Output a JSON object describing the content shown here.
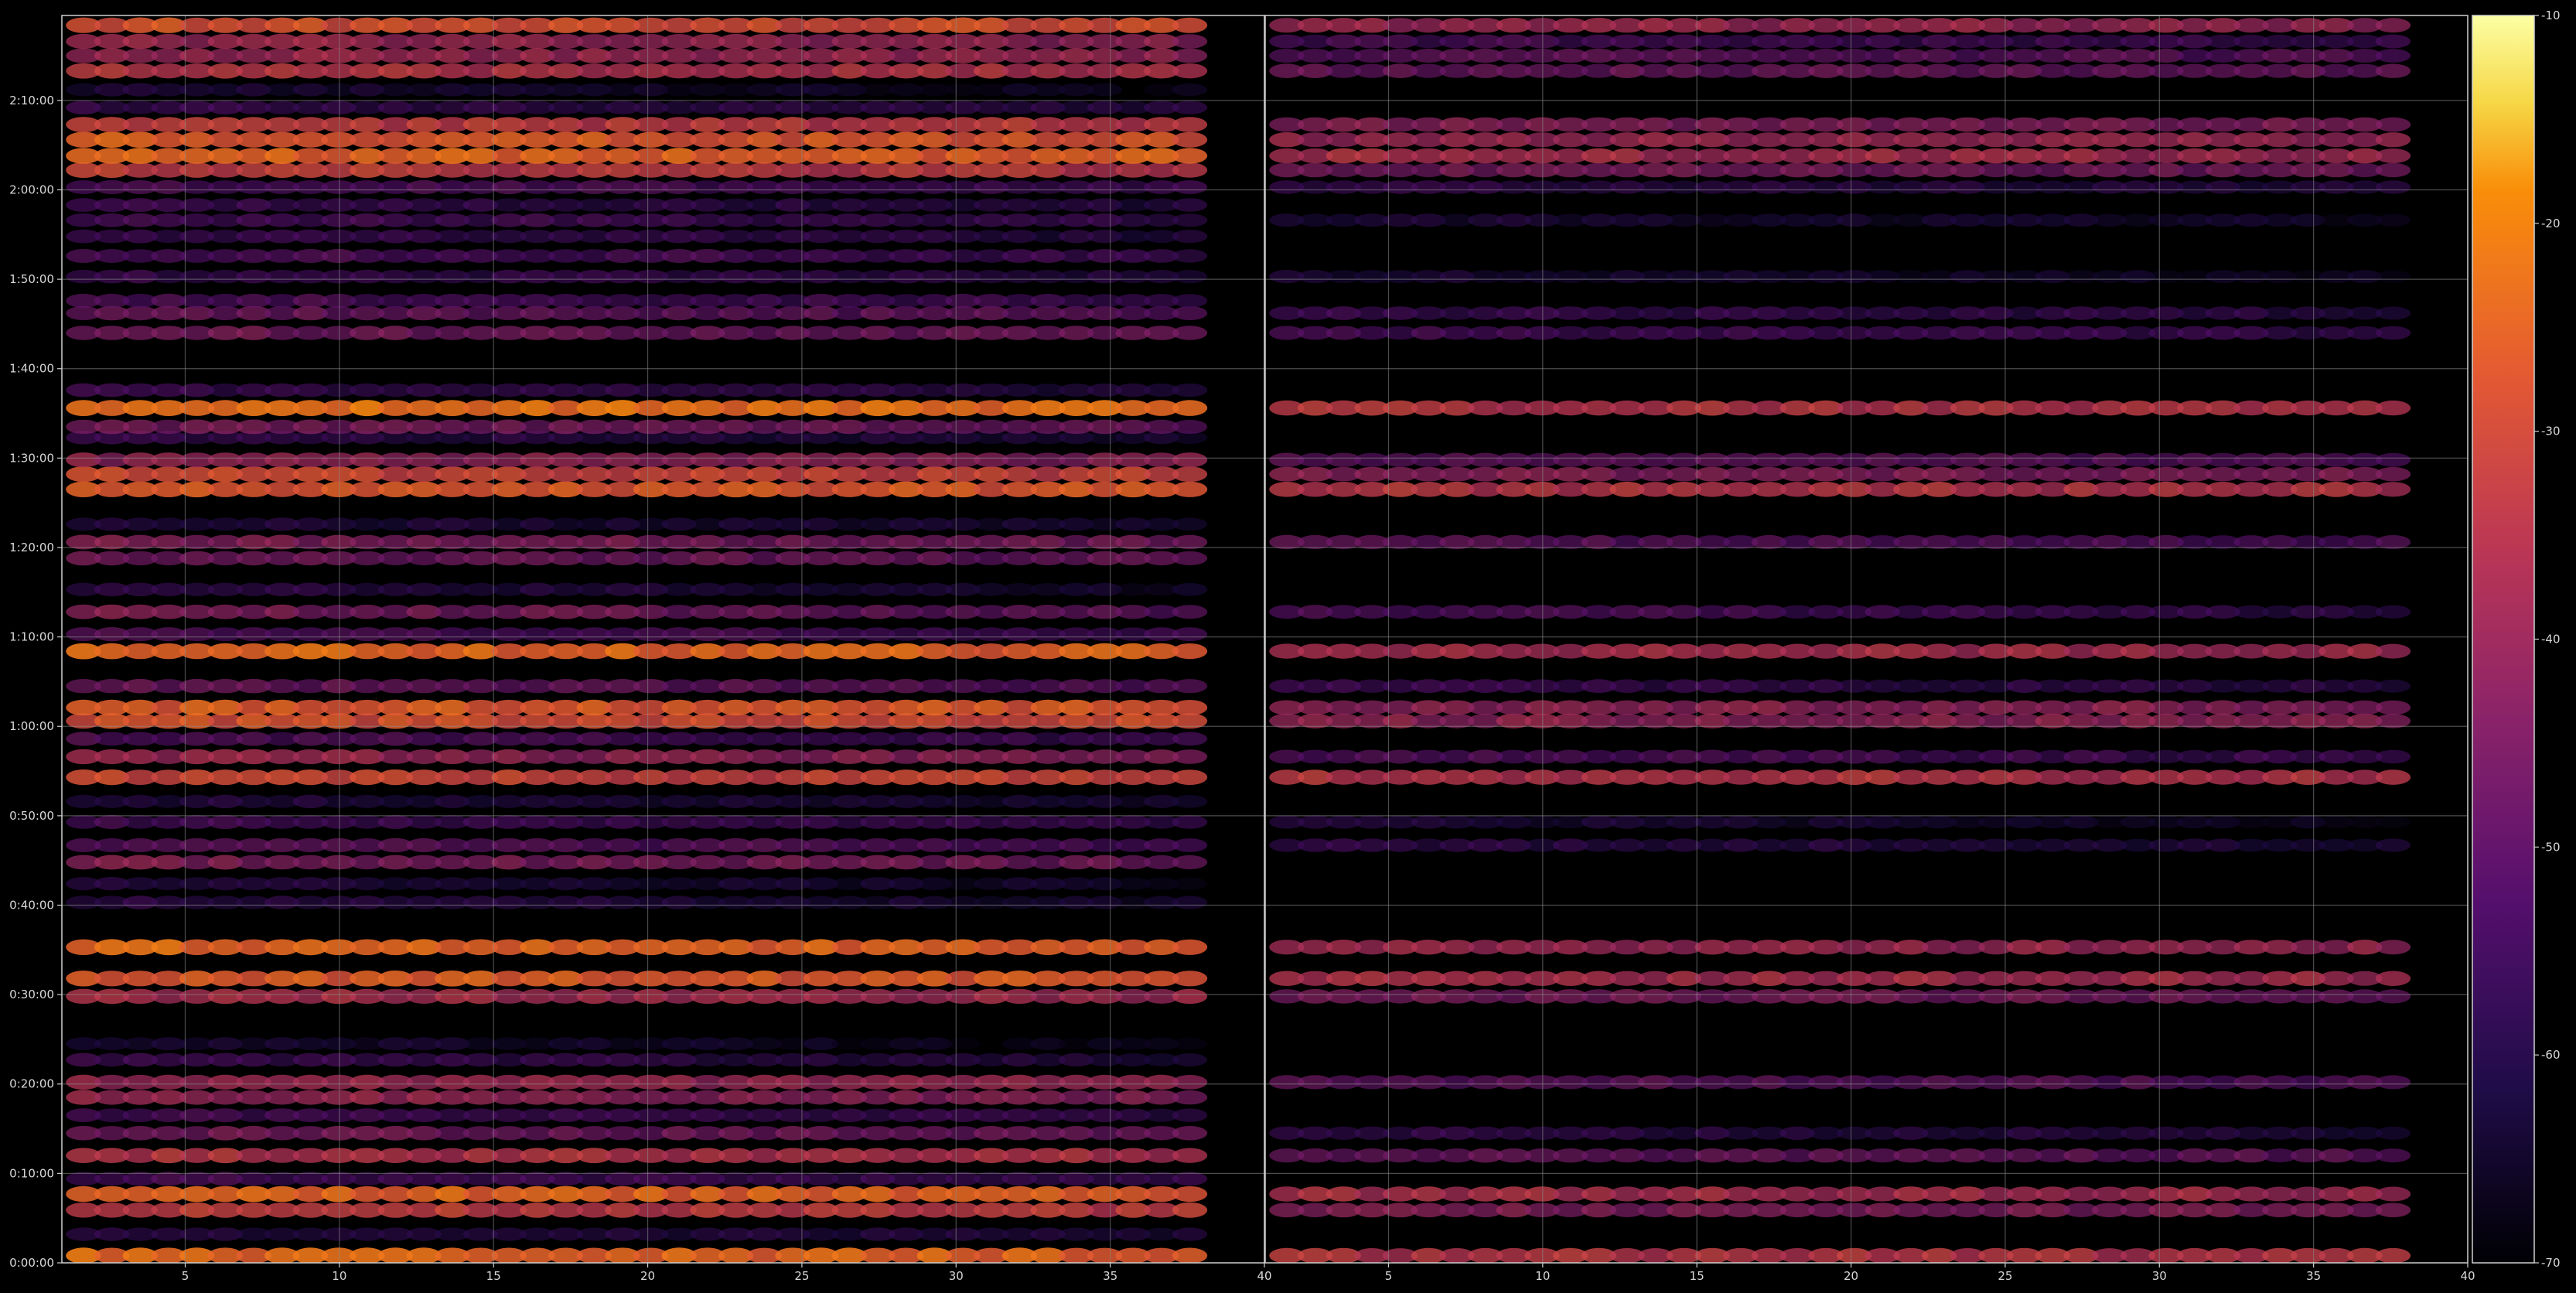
{
  "chart_data": {
    "type": "heatmap",
    "title": "",
    "xlabel": "",
    "ylabel": "",
    "colormap": "inferno",
    "background": "#000000",
    "grid": true,
    "grid_color": "#8a8a8a",
    "color_range": [
      -70,
      -10
    ],
    "colorbar_ticks": [
      "-10",
      "-20",
      "-30",
      "-40",
      "-50",
      "-60",
      "-70"
    ],
    "y_tick_labels": [
      "0:00:00",
      "0:10:00",
      "0:20:00",
      "0:30:00",
      "0:40:00",
      "0:50:00",
      "1:00:00",
      "1:10:00",
      "1:20:00",
      "1:30:00",
      "1:40:00",
      "1:50:00",
      "2:00:00",
      "2:10:00"
    ],
    "y_range_minutes": [
      0,
      139.5
    ],
    "panels": [
      {
        "name": "left",
        "x_range": [
          1,
          40
        ],
        "x_ticks": [
          "5",
          "10",
          "15",
          "20",
          "25",
          "30",
          "35",
          "40"
        ],
        "column_start": 1.7,
        "column_step": 0.92,
        "column_count": 40,
        "bands": [
          {
            "t": 0.8,
            "level": -24,
            "decay": 0.1
          },
          {
            "t": 3.2,
            "level": -58,
            "decay": 0.2
          },
          {
            "t": 5.9,
            "level": -32,
            "decay": 0.1
          },
          {
            "t": 7.7,
            "level": -24,
            "decay": 0.15
          },
          {
            "t": 9.4,
            "level": -52,
            "decay": 0.3
          },
          {
            "t": 12.0,
            "level": -34,
            "decay": 0.15
          },
          {
            "t": 14.5,
            "level": -44,
            "decay": 0.3
          },
          {
            "t": 16.5,
            "level": -52,
            "decay": 0.4
          },
          {
            "t": 18.5,
            "level": -38,
            "decay": 0.4
          },
          {
            "t": 20.2,
            "level": -38,
            "decay": 0.15
          },
          {
            "t": 22.7,
            "level": -54,
            "decay": 0.4
          },
          {
            "t": 24.5,
            "level": -60,
            "decay": 0.6
          },
          {
            "t": 29.8,
            "level": -36,
            "decay": 0.15
          },
          {
            "t": 31.8,
            "level": -26,
            "decay": 0.1
          },
          {
            "t": 35.3,
            "level": -24,
            "decay": 0.1
          },
          {
            "t": 40.3,
            "level": -56,
            "decay": 0.6
          },
          {
            "t": 42.4,
            "level": -58,
            "decay": 0.5
          },
          {
            "t": 44.8,
            "level": -42,
            "decay": 0.35
          },
          {
            "t": 46.7,
            "level": -48,
            "decay": 0.3
          },
          {
            "t": 49.3,
            "level": -52,
            "decay": 0.4
          },
          {
            "t": 51.6,
            "level": -58,
            "decay": 0.4
          },
          {
            "t": 54.3,
            "level": -30,
            "decay": 0.12
          },
          {
            "t": 56.6,
            "level": -38,
            "decay": 0.4
          },
          {
            "t": 58.6,
            "level": -50,
            "decay": 0.4
          },
          {
            "t": 60.6,
            "level": -28,
            "decay": 0.12
          },
          {
            "t": 62.1,
            "level": -26,
            "decay": 0.12
          },
          {
            "t": 64.5,
            "level": -46,
            "decay": 0.3
          },
          {
            "t": 68.4,
            "level": -24,
            "decay": 0.12
          },
          {
            "t": 70.3,
            "level": -50,
            "decay": 0.3
          },
          {
            "t": 72.8,
            "level": -42,
            "decay": 0.6
          },
          {
            "t": 75.3,
            "level": -56,
            "decay": 0.6
          },
          {
            "t": 78.8,
            "level": -44,
            "decay": 0.3
          },
          {
            "t": 80.6,
            "level": -42,
            "decay": 0.3
          },
          {
            "t": 82.6,
            "level": -58,
            "decay": 0.4
          },
          {
            "t": 86.5,
            "level": -26,
            "decay": 0.12
          },
          {
            "t": 88.2,
            "level": -30,
            "decay": 0.12
          },
          {
            "t": 89.8,
            "level": -40,
            "decay": 0.15
          },
          {
            "t": 92.3,
            "level": -56,
            "decay": 0.4
          },
          {
            "t": 93.5,
            "level": -44,
            "decay": 0.3
          },
          {
            "t": 95.6,
            "level": -22,
            "decay": 0.12
          },
          {
            "t": 97.6,
            "level": -54,
            "decay": 0.4
          },
          {
            "t": 104.0,
            "level": -44,
            "decay": 0.25
          },
          {
            "t": 106.2,
            "level": -46,
            "decay": 0.25
          },
          {
            "t": 107.6,
            "level": -50,
            "decay": 0.4
          },
          {
            "t": 110.3,
            "level": -54,
            "decay": 0.4
          },
          {
            "t": 112.6,
            "level": -50,
            "decay": 0.35
          },
          {
            "t": 114.8,
            "level": -54,
            "decay": 0.4
          },
          {
            "t": 116.6,
            "level": -52,
            "decay": 0.3
          },
          {
            "t": 118.3,
            "level": -54,
            "decay": 0.4
          },
          {
            "t": 120.3,
            "level": -50,
            "decay": 0.3
          },
          {
            "t": 122.2,
            "level": -32,
            "decay": 0.15
          },
          {
            "t": 123.8,
            "level": -24,
            "decay": 0.15
          },
          {
            "t": 125.6,
            "level": -26,
            "decay": 0.12
          },
          {
            "t": 127.3,
            "level": -32,
            "decay": 0.12
          },
          {
            "t": 129.2,
            "level": -54,
            "decay": 0.4
          },
          {
            "t": 131.2,
            "level": -60,
            "decay": 0.5
          },
          {
            "t": 133.3,
            "level": -34,
            "decay": 0.12
          },
          {
            "t": 135.0,
            "level": -38,
            "decay": 0.15
          },
          {
            "t": 136.6,
            "level": -38,
            "decay": 0.25
          },
          {
            "t": 138.4,
            "level": -28,
            "decay": 0.1
          }
        ]
      },
      {
        "name": "right",
        "x_range": [
          1,
          40
        ],
        "x_ticks": [
          "5",
          "10",
          "15",
          "20",
          "25",
          "30",
          "35",
          "40"
        ],
        "column_start": 1.7,
        "column_step": 0.92,
        "column_count": 40,
        "bands": [
          {
            "t": 0.8,
            "level": -34,
            "decay": 0.1
          },
          {
            "t": 5.9,
            "level": -42,
            "decay": 0.15
          },
          {
            "t": 7.7,
            "level": -36,
            "decay": 0.15
          },
          {
            "t": 12.0,
            "level": -46,
            "decay": 0.2
          },
          {
            "t": 14.5,
            "level": -56,
            "decay": 0.3
          },
          {
            "t": 20.2,
            "level": -48,
            "decay": 0.2
          },
          {
            "t": 29.8,
            "level": -44,
            "decay": 0.15
          },
          {
            "t": 31.8,
            "level": -36,
            "decay": 0.1
          },
          {
            "t": 35.3,
            "level": -38,
            "decay": 0.1
          },
          {
            "t": 46.7,
            "level": -56,
            "decay": 0.3
          },
          {
            "t": 49.3,
            "level": -60,
            "decay": 0.4
          },
          {
            "t": 54.3,
            "level": -34,
            "decay": 0.12
          },
          {
            "t": 56.6,
            "level": -50,
            "decay": 0.4
          },
          {
            "t": 60.6,
            "level": -40,
            "decay": 0.12
          },
          {
            "t": 62.1,
            "level": -40,
            "decay": 0.12
          },
          {
            "t": 64.5,
            "level": -54,
            "decay": 0.3
          },
          {
            "t": 68.4,
            "level": -36,
            "decay": 0.12
          },
          {
            "t": 72.8,
            "level": -50,
            "decay": 0.6
          },
          {
            "t": 80.6,
            "level": -48,
            "decay": 0.3
          },
          {
            "t": 86.5,
            "level": -34,
            "decay": 0.12
          },
          {
            "t": 88.2,
            "level": -42,
            "decay": 0.12
          },
          {
            "t": 89.8,
            "level": -48,
            "decay": 0.15
          },
          {
            "t": 95.6,
            "level": -34,
            "decay": 0.12
          },
          {
            "t": 104.0,
            "level": -52,
            "decay": 0.35
          },
          {
            "t": 106.2,
            "level": -54,
            "decay": 0.3
          },
          {
            "t": 110.3,
            "level": -60,
            "decay": 0.4
          },
          {
            "t": 116.6,
            "level": -60,
            "decay": 0.35
          },
          {
            "t": 120.3,
            "level": -56,
            "decay": 0.3
          },
          {
            "t": 122.2,
            "level": -44,
            "decay": 0.15
          },
          {
            "t": 123.8,
            "level": -36,
            "decay": 0.15
          },
          {
            "t": 125.6,
            "level": -38,
            "decay": 0.12
          },
          {
            "t": 127.3,
            "level": -42,
            "decay": 0.12
          },
          {
            "t": 133.3,
            "level": -46,
            "decay": 0.12
          },
          {
            "t": 135.0,
            "level": -48,
            "decay": 0.15
          },
          {
            "t": 136.6,
            "level": -52,
            "decay": 0.25
          },
          {
            "t": 138.4,
            "level": -38,
            "decay": 0.1
          }
        ]
      }
    ]
  }
}
